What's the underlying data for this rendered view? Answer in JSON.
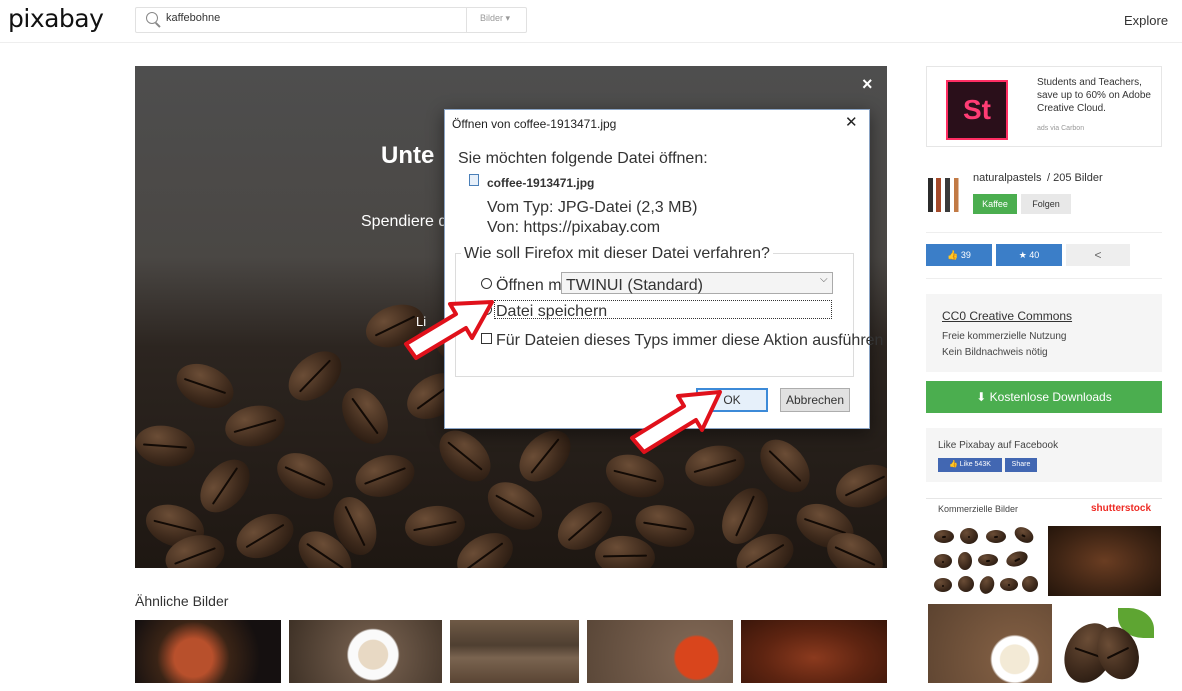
{
  "header": {
    "logo": "pixabay",
    "search_value": "kaffebohne",
    "search_type": "Bilder ▾",
    "explore": "Explore"
  },
  "hero": {
    "title": "Unte",
    "subtitle": "Spendiere d",
    "link": "Li",
    "close": "×"
  },
  "dialog": {
    "title": "Öffnen von coffee-1913471.jpg",
    "close": "✕",
    "prompt": "Sie möchten folgende Datei öffnen:",
    "file_name": "coffee-1913471.jpg",
    "file_type": "Vom Typ: JPG-Datei (2,3 MB)",
    "file_from": "Von: https://pixabay.com",
    "question": "Wie soll Firefox mit dieser Datei verfahren?",
    "open_with_label": "Öffnen mit",
    "open_with_app": "TWINUI (Standard)",
    "save_label": "Datei speichern",
    "always_label": "Für Dateien dieses Typs immer diese Aktion ausführen",
    "ok": "OK",
    "cancel": "Abbrechen",
    "selected_option": "Datei speichern"
  },
  "similar": {
    "title": "Ähnliche Bilder"
  },
  "sidebar": {
    "ad_logo": "St",
    "ad_text": "Students and Teachers, save up to 60% on Adobe Creative Cloud.",
    "ad_via": "ads via Carbon",
    "user": "naturalpastels",
    "user_count": "/ 205 Bilder",
    "coffee_btn": "Kaffee",
    "follow_btn": "Folgen",
    "likes": "👍 39",
    "favorites": "★ 40",
    "share": "<",
    "license_title": "CC0 Creative Commons",
    "license_line1": "Freie kommerzielle Nutzung",
    "license_line2": "Kein Bildnachweis nötig",
    "download": "⬇ Kostenlose Downloads",
    "fb_label": "Like Pixabay auf Facebook",
    "fb_like": "👍 Like 543K",
    "fb_share": "Share",
    "commercial_label": "Kommerzielle Bilder",
    "shutterstock": "shutterstock"
  },
  "colors": {
    "green": "#4bae4f",
    "blue": "#3b7ec8",
    "arrow_red": "#e0111b",
    "dialog_accent": "#3c8ad8"
  }
}
